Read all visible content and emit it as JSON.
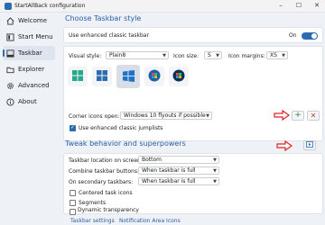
{
  "window": {
    "title": "StartAllBack configuration"
  },
  "sidebar": {
    "items": [
      {
        "label": "Welcome",
        "icon": "home-icon"
      },
      {
        "label": "Start Menu",
        "icon": "start-menu-icon"
      },
      {
        "label": "Taskbar",
        "icon": "taskbar-icon",
        "active": true
      },
      {
        "label": "Explorer",
        "icon": "folder-icon"
      },
      {
        "label": "Advanced",
        "icon": "gear-icon"
      },
      {
        "label": "About",
        "icon": "info-icon"
      }
    ]
  },
  "style_section": {
    "title": "Choose Taskbar style",
    "enhanced_label": "Use enhanced classic taskbar",
    "toggle_state": "On",
    "visual_style_label": "Visual style:",
    "visual_style_value": "Plain8",
    "icon_size_label": "Icon size:",
    "icon_size_value": "S",
    "icon_margins_label": "Icon margins:",
    "icon_margins_value": "XS",
    "corner_icons_label": "Corner icons open:",
    "corner_icons_value": "Windows 10 flyouts if possible",
    "jumplists_label": "Use enhanced classic jumplists"
  },
  "behavior_section": {
    "title": "Tweak behavior and superpowers",
    "location_label": "Taskbar location on screen:",
    "location_value": "Bottom",
    "combine_label": "Combine taskbar buttons:",
    "combine_value": "When taskbar is full",
    "secondary_label": "On secondary taskbars:",
    "secondary_value": "When taskbar is full",
    "centered_label": "Centered task icons",
    "segments_label": "Segments",
    "dynamic_label": "Dynamic transparency"
  },
  "links": {
    "taskbar_settings": "Taskbar settings",
    "notification_icons": "Notification Area Icons"
  },
  "colors": {
    "accent": "#2b6cb0",
    "annotation_arrow": "#e02020",
    "add_green": "#2e8b3a",
    "remove_red": "#c0392b"
  }
}
